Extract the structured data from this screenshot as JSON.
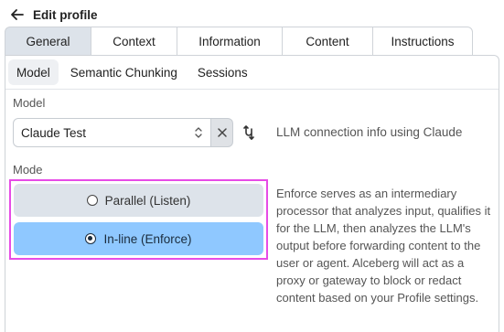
{
  "header": {
    "title": "Edit profile",
    "back_icon": "arrow-left-icon"
  },
  "tabs": [
    {
      "label": "General",
      "active": true
    },
    {
      "label": "Context",
      "active": false
    },
    {
      "label": "Information",
      "active": false
    },
    {
      "label": "Content",
      "active": false
    },
    {
      "label": "Instructions",
      "active": false
    }
  ],
  "subtabs": [
    {
      "label": "Model",
      "active": true
    },
    {
      "label": "Semantic Chunking",
      "active": false
    },
    {
      "label": "Sessions",
      "active": false
    }
  ],
  "model": {
    "label": "Model",
    "selected": "Claude Test",
    "info": "LLM connection info using Claude"
  },
  "mode": {
    "label": "Mode",
    "options": [
      {
        "label": "Parallel (Listen)",
        "selected": false
      },
      {
        "label": "In-line (Enforce)",
        "selected": true
      }
    ],
    "description": "Enforce serves as an intermediary processor that analyzes input, qualifies it for the LLM, then analyzes the LLM's output before forwarding content to the user or agent. Alceberg will act as a proxy or gateway to block or redact content based on your Profile settings."
  },
  "colors": {
    "active_tab": "#dde3ea",
    "selected_option": "#8fc8ff",
    "highlight_border": "#e64ce6"
  }
}
